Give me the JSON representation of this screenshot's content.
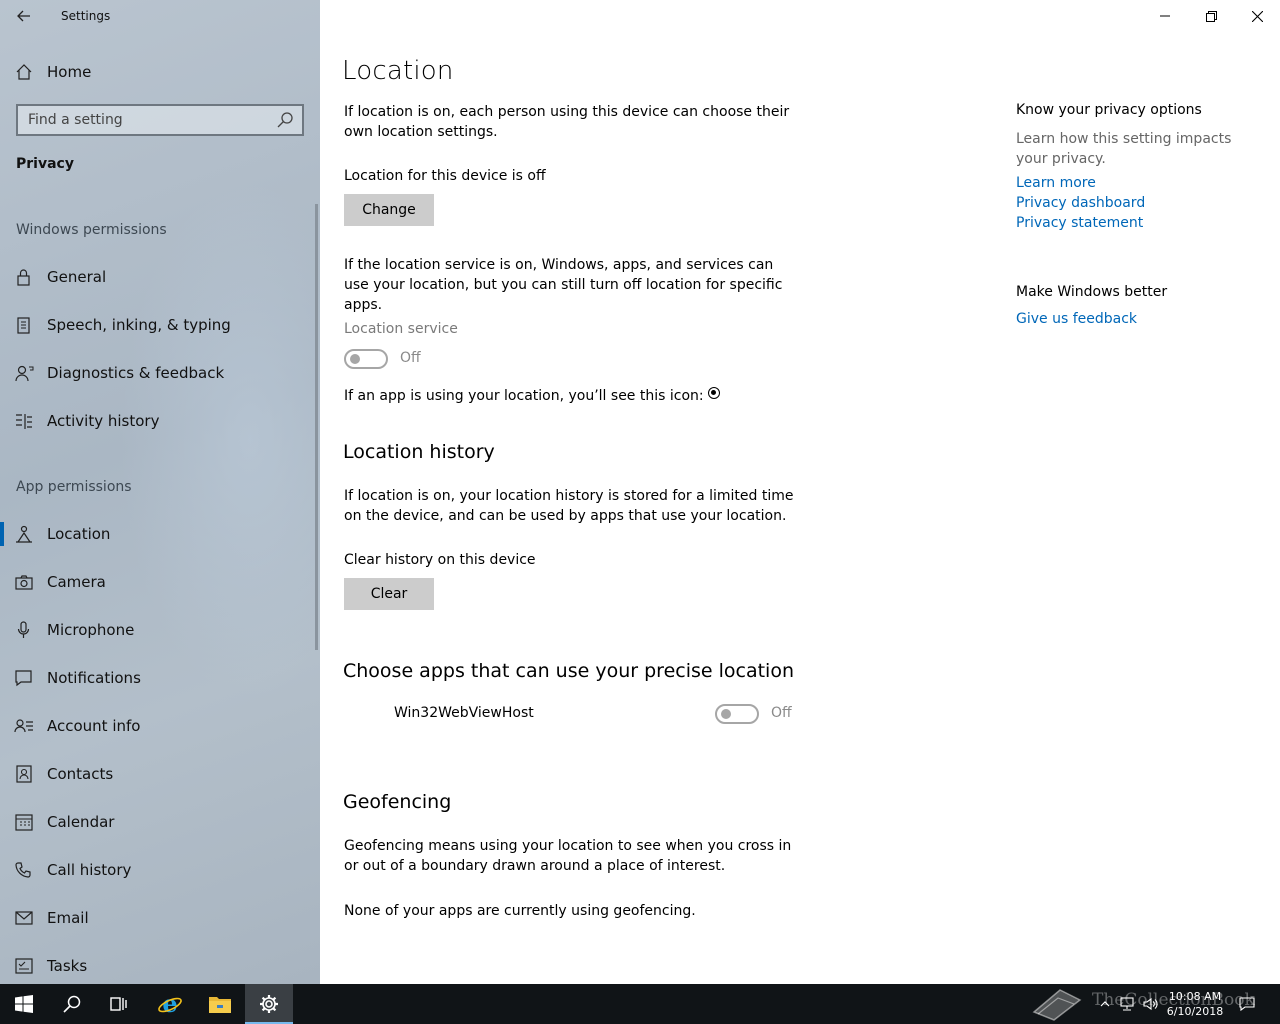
{
  "window": {
    "title": "Settings",
    "back_icon": "back-arrow-icon",
    "controls": [
      "minimize-icon",
      "restore-icon",
      "close-icon"
    ]
  },
  "sidebar": {
    "home_label": "Home",
    "search_placeholder": "Find a setting",
    "category": "Privacy",
    "windows_permissions_title": "Windows permissions",
    "windows_permissions": [
      {
        "label": "General",
        "icon": "lock-icon"
      },
      {
        "label": "Speech, inking, & typing",
        "icon": "clipboard-icon"
      },
      {
        "label": "Diagnostics & feedback",
        "icon": "person-feedback-icon"
      },
      {
        "label": "Activity history",
        "icon": "timeline-icon"
      }
    ],
    "app_permissions_title": "App permissions",
    "app_permissions": [
      {
        "label": "Location",
        "icon": "location-person-icon",
        "active": true
      },
      {
        "label": "Camera",
        "icon": "camera-icon"
      },
      {
        "label": "Microphone",
        "icon": "microphone-icon"
      },
      {
        "label": "Notifications",
        "icon": "notification-icon"
      },
      {
        "label": "Account info",
        "icon": "account-info-icon"
      },
      {
        "label": "Contacts",
        "icon": "contacts-icon"
      },
      {
        "label": "Calendar",
        "icon": "calendar-icon"
      },
      {
        "label": "Call history",
        "icon": "phone-icon"
      },
      {
        "label": "Email",
        "icon": "mail-icon"
      },
      {
        "label": "Tasks",
        "icon": "tasks-icon"
      }
    ]
  },
  "main": {
    "title": "Location",
    "intro": "If location is on, each person using this device can choose their own location settings.",
    "device_status": "Location for this device is off",
    "change_button": "Change",
    "service_desc": "If the location service is on, Windows, apps, and services can use your location, but you can still turn off location for specific apps.",
    "service_label": "Location service",
    "service_state": "Off",
    "icon_note": "If an app is using your location, you’ll see this icon:",
    "history_title": "Location history",
    "history_desc": "If location is on, your location history is stored for a limited time on the device, and can be used by apps that use your location.",
    "clear_label": "Clear history on this device",
    "clear_button": "Clear",
    "apps_title": "Choose apps that can use your precise location",
    "apps": [
      {
        "name": "Win32WebViewHost",
        "state": "Off"
      }
    ],
    "geofencing_title": "Geofencing",
    "geofencing_desc": "Geofencing means using your location to see when you cross in or out of a boundary drawn around a place of interest.",
    "geofencing_status": "None of your apps are currently using geofencing."
  },
  "right_panel": {
    "privacy_title": "Know your privacy options",
    "privacy_desc": "Learn how this setting impacts your privacy.",
    "links": [
      "Learn more",
      "Privacy dashboard",
      "Privacy statement"
    ],
    "better_title": "Make Windows better",
    "feedback_link": "Give us feedback"
  },
  "taskbar": {
    "items": [
      "windows-start-icon",
      "search-icon",
      "task-view-icon",
      "internet-explorer-icon",
      "file-explorer-icon",
      "settings-gear-icon"
    ],
    "active_item": "settings-gear-icon",
    "clock_time": "10:08 AM",
    "clock_date": "6/10/2018",
    "watermark_text": "TheCollectionBook"
  },
  "colors": {
    "accent": "#0063b1",
    "link": "#0067b8",
    "taskbar": "#101417",
    "button": "#cccccc"
  }
}
